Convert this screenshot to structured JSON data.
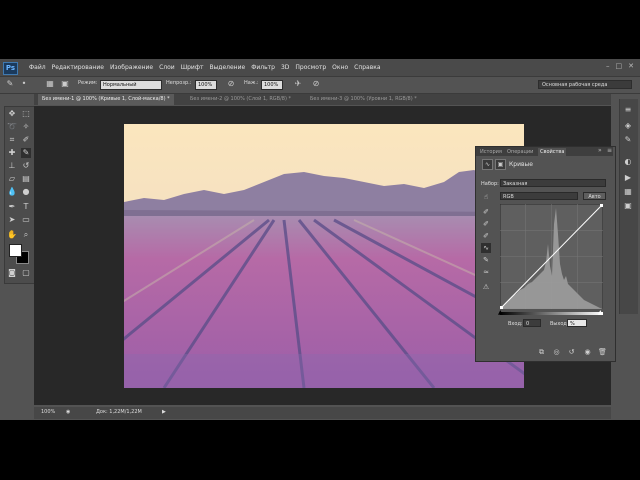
{
  "app": {
    "logo": "Ps"
  },
  "menu": [
    "Файл",
    "Редактирование",
    "Изображение",
    "Слои",
    "Шрифт",
    "Выделение",
    "Фильтр",
    "3D",
    "Просмотр",
    "Окно",
    "Справка"
  ],
  "options": {
    "mode_label": "Режим:",
    "mode_value": "Нормальный",
    "opacity_label": "Непрозр.:",
    "opacity_value": "100%",
    "flow_label": "Наж.:",
    "flow_value": "100%"
  },
  "workspace": "Основная рабочая среда",
  "tabs": [
    {
      "label": "Без имени-1 @ 100% (Кривые 1, Слой-маска/8) *",
      "active": true
    },
    {
      "label": "Без имени-2 @ 100% (Слой 1, RGB/8) *",
      "active": false
    },
    {
      "label": "Без имени-3 @ 100% (Уровни 1, RGB/8) *",
      "active": false
    }
  ],
  "status": {
    "zoom": "100%",
    "doc": "Док: 1,22M/1,22M"
  },
  "panel": {
    "tabs": [
      "История",
      "Операции",
      "Свойства"
    ],
    "title": "Кривые",
    "preset_label": "Набор:",
    "preset_value": "Заказная",
    "channel_value": "RGB",
    "auto_label": "Авто",
    "input_label": "Вход:",
    "input_value": "0",
    "output_label": "Выход:",
    "output_value": "%"
  },
  "colors": {
    "accent": "#3f79b0",
    "foreground": "#ffffff",
    "background": "#000000"
  },
  "icons": {
    "tools": [
      "move-icon",
      "marquee-icon",
      "lasso-icon",
      "quick-select-icon",
      "crop-icon",
      "eyedropper-icon",
      "healing-icon",
      "brush-icon",
      "stamp-icon",
      "history-brush-icon",
      "eraser-icon",
      "gradient-icon",
      "blur-icon",
      "dodge-icon",
      "pen-icon",
      "type-icon",
      "path-select-icon",
      "shape-icon",
      "hand-icon",
      "zoom-icon"
    ]
  }
}
